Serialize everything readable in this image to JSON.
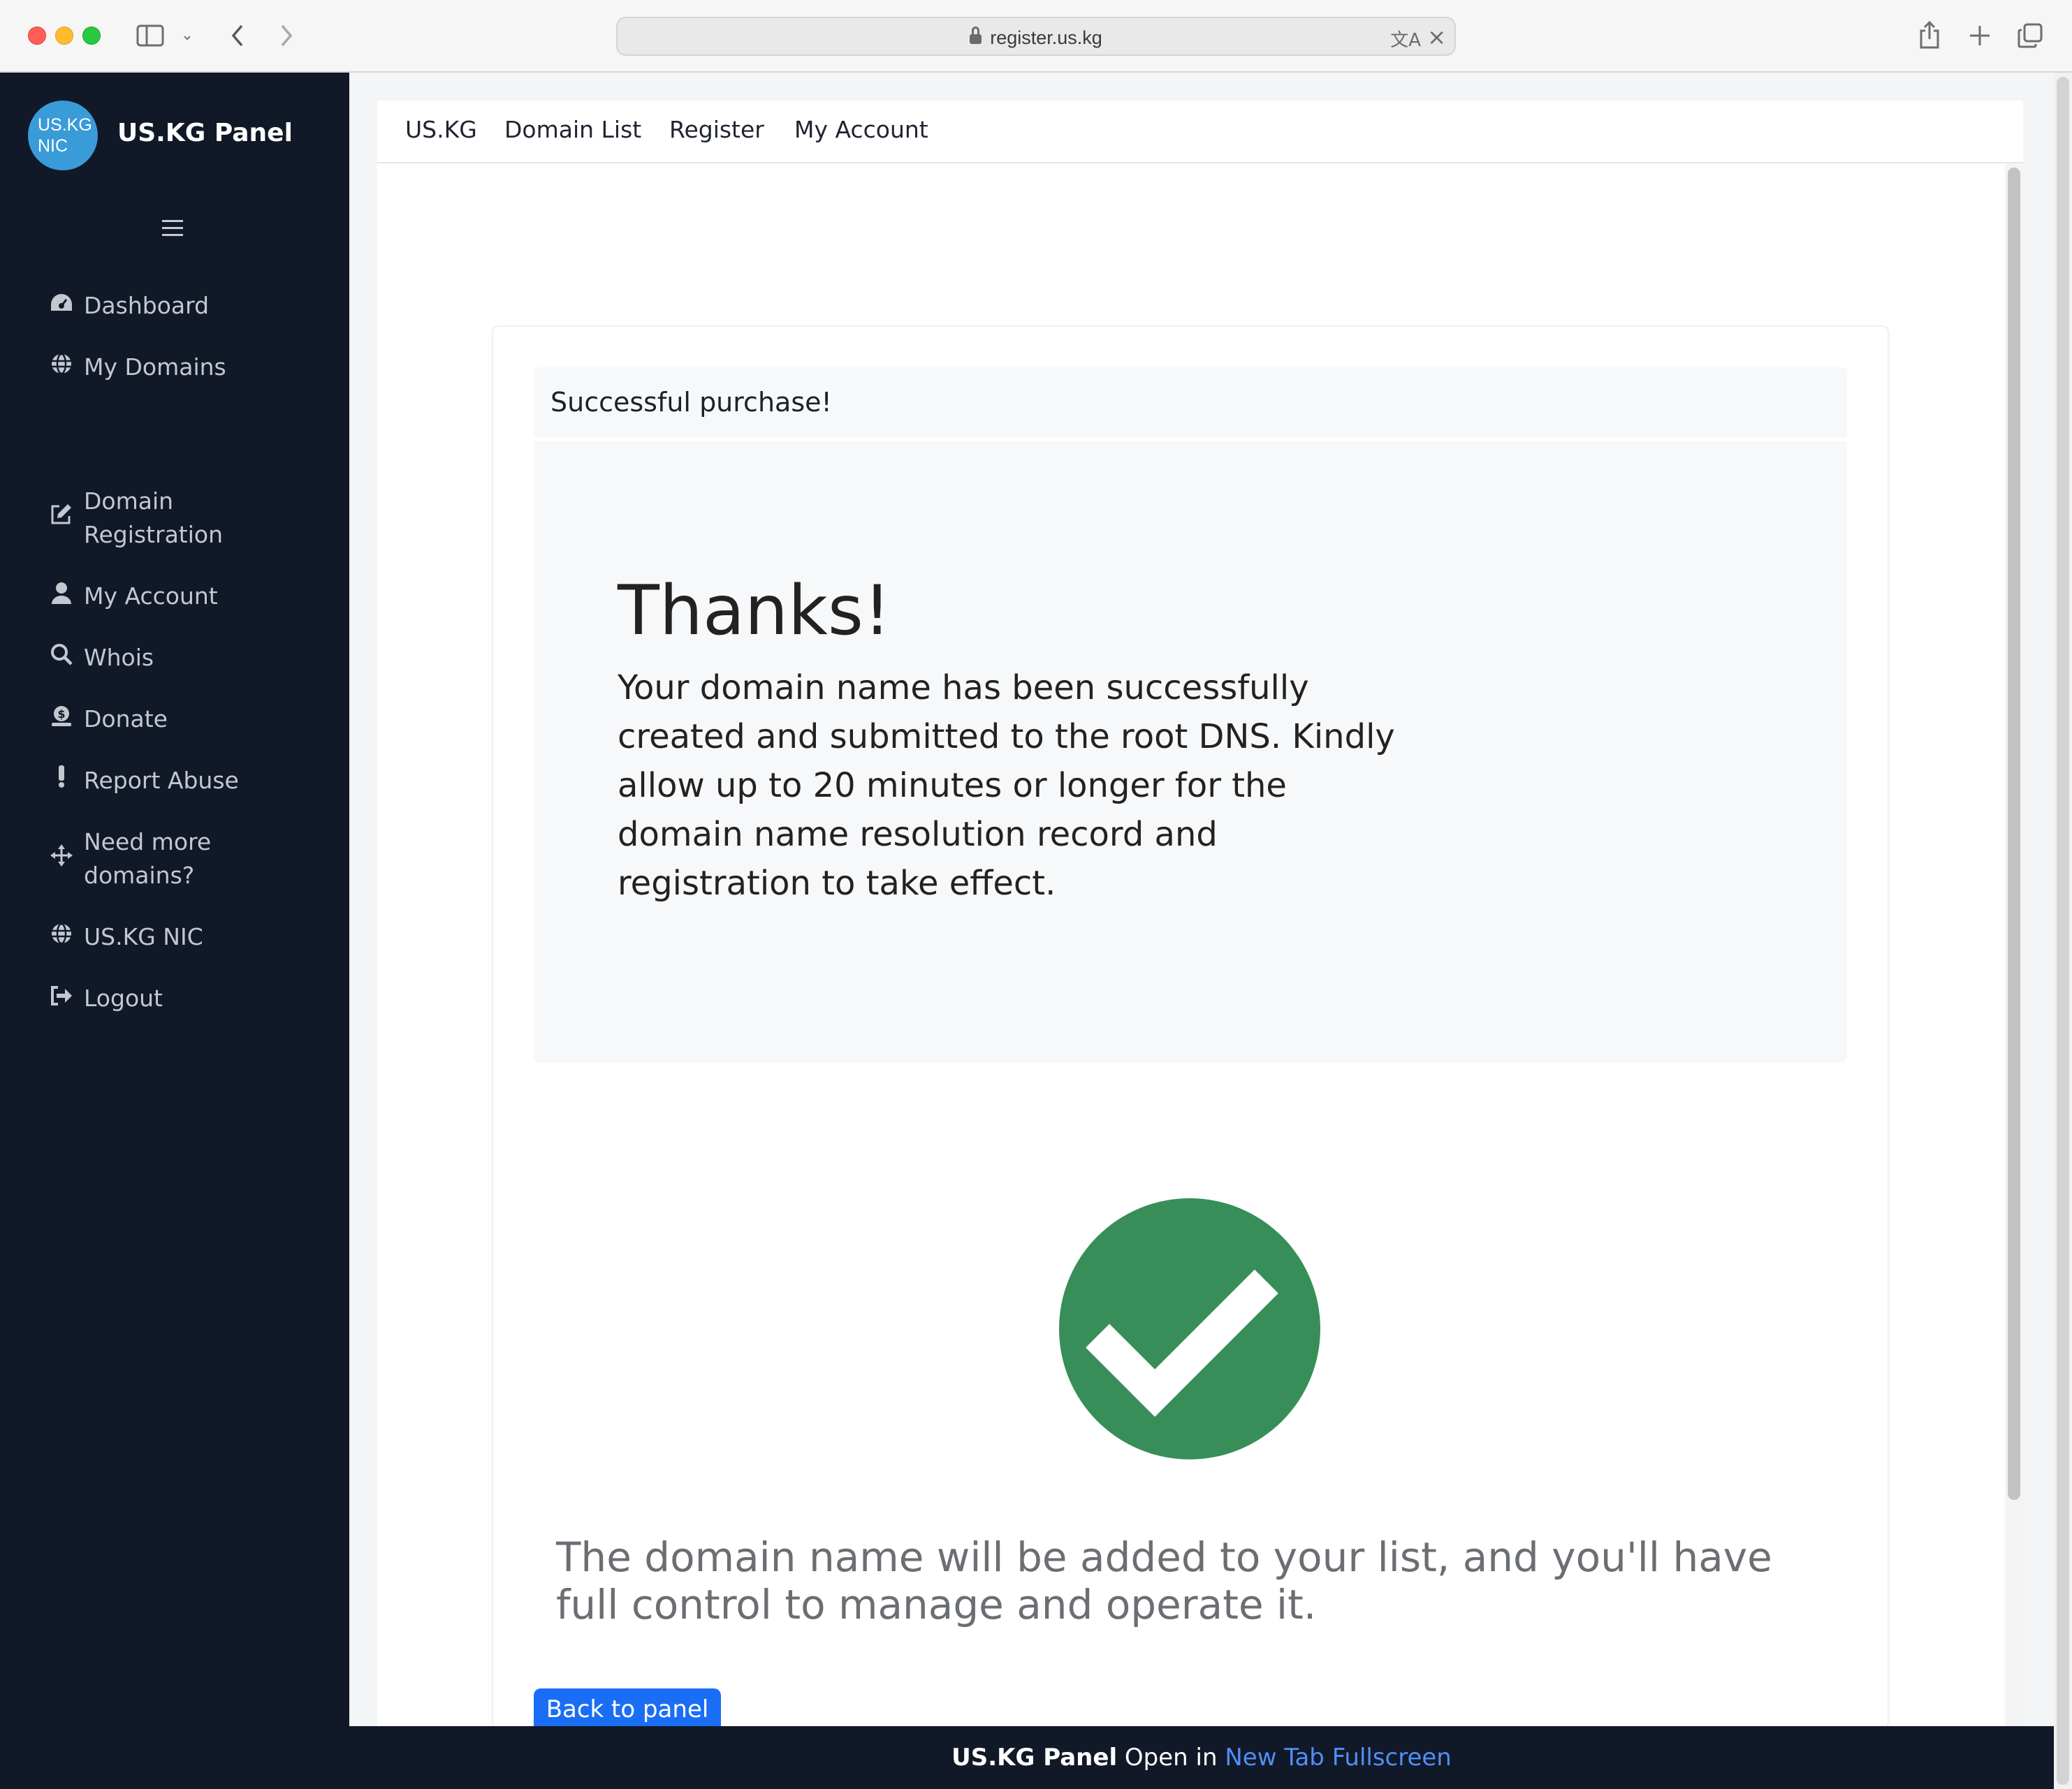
{
  "browser": {
    "url": "register.us.kg"
  },
  "sidebar": {
    "logo_text": "US.KG NIC",
    "title": "US.KG Panel",
    "items": [
      {
        "label": "Dashboard",
        "icon": "dashboard-icon"
      },
      {
        "label": "My Domains",
        "icon": "globe-icon"
      },
      {
        "label": "Domain\nRegistration",
        "icon": "edit-icon"
      },
      {
        "label": "My Account",
        "icon": "user-icon"
      },
      {
        "label": "Whois",
        "icon": "search-icon"
      },
      {
        "label": "Donate",
        "icon": "donate-icon"
      },
      {
        "label": "Report Abuse",
        "icon": "exclamation-icon"
      },
      {
        "label": "Need more\ndomains?",
        "icon": "arrows-icon"
      },
      {
        "label": "US.KG NIC",
        "icon": "globe-icon"
      },
      {
        "label": "Logout",
        "icon": "logout-icon"
      }
    ]
  },
  "topnav": {
    "items": [
      "US.KG",
      "Domain List",
      "Register",
      "My Account"
    ]
  },
  "card": {
    "header": "Successful purchase!",
    "title": "Thanks!",
    "message": "Your domain name has been successfully created and submitted to the root DNS. Kindly allow up to 20 minutes or longer for the domain name resolution record and registration to take effect.",
    "lead": "The domain name will be added to your list, and you'll have full control to manage and operate it.",
    "button": "Back to panel"
  },
  "footer": {
    "brand": "US.KG Panel",
    "open_in": "Open in",
    "link": "New Tab Fullscreen"
  },
  "colors": {
    "sidebar_bg": "#111827",
    "success": "#388e58",
    "primary": "#1a6ef5"
  }
}
